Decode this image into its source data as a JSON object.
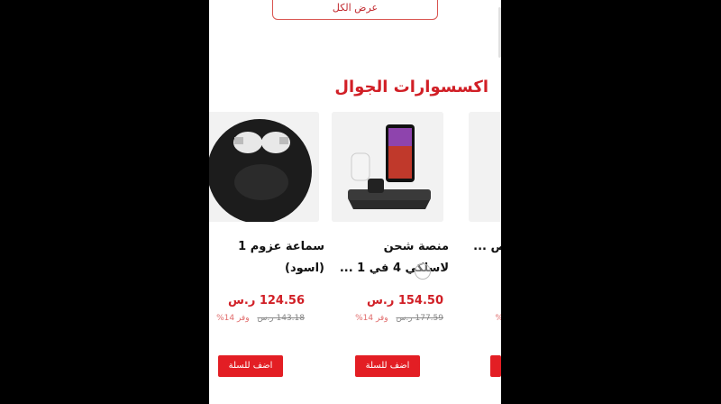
{
  "top_button": {
    "label": "عرض الكل"
  },
  "section": {
    "title": "اكسسوارات الجوال"
  },
  "products": [
    {
      "name_line1": "سماعة عزوم 1",
      "name_line2": "(اسود)",
      "price": "124.56 ر.س",
      "old_price": "143.18 ر.س",
      "discount": "وفر 14%",
      "add_label": "اضف للسلة",
      "image_icon": "headphones-icon"
    },
    {
      "name_line1": "منصة شحن",
      "name_line2": "لاسلكي 4 في 1 ...",
      "price": "154.50 ر.س",
      "old_price": "177.59 ر.س",
      "discount": "وفر 14%",
      "add_label": "اضف للسلة",
      "image_icon": "charging-dock-icon"
    },
    {
      "name_line1": "",
      "name_line2": "ص ...",
      "price": "",
      "old_price": "",
      "discount": "%",
      "add_label": "",
      "image_icon": "product-image"
    }
  ],
  "colors": {
    "accent": "#d11f26",
    "button": "#e31e24"
  }
}
